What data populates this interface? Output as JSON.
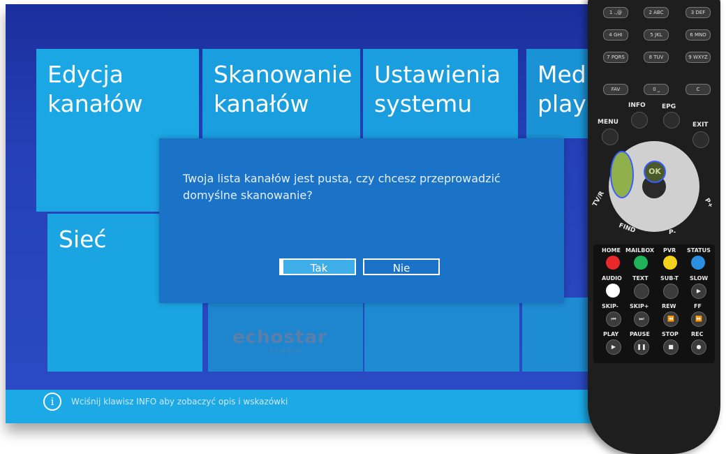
{
  "screen": {
    "tiles": {
      "edycja": "Edycja\nkanałów",
      "skanowanie": "Skanowanie\nkanałów",
      "ustawienia": "Ustawienia\nsystemu",
      "media": "Media\nplayer",
      "siec": "Sieć"
    },
    "logo": "echostar",
    "logo_sub": "STUDIO"
  },
  "dialog": {
    "message": "Twoja lista kanałów jest pusta, czy chcesz przeprowadzić domyślne skanowanie?",
    "yes_label": "Tak",
    "no_label": "Nie"
  },
  "infobar": {
    "icon_label": "i",
    "text": "Wciśnij klawisz INFO aby zobaczyć opis i wskazówki"
  },
  "remote": {
    "keys": [
      "1 .,@",
      "2 ABC",
      "3 DEF",
      "4 GHI",
      "5 JKL",
      "6 MNO",
      "7 PQRS",
      "8 TUV",
      "9 WXYZ",
      "FAV",
      "0 ⎵",
      "C"
    ],
    "labels": {
      "info": "INFO",
      "epg": "EPG",
      "menu": "MENU",
      "exit": "EXIT",
      "ok": "OK",
      "tvr": "TV/R",
      "pplus": "P+",
      "find": "FIND",
      "pminus": "P-",
      "home": "HOME",
      "mailbox": "MAILBOX",
      "pvr": "PVR",
      "status": "STATUS",
      "audio": "AUDIO",
      "text": "TEXT",
      "subt": "SUB-T",
      "slow": "SLOW",
      "skipm": "SKIP-",
      "skipp": "SKIP+",
      "rew": "REW",
      "ff": "FF",
      "play": "PLAY",
      "pause": "PAUSE",
      "stop": "STOP",
      "rec": "REC"
    },
    "colors": {
      "red": "#e8282b",
      "green": "#1fb45a",
      "yellow": "#f2d21a",
      "blue": "#2a8fe0",
      "white": "#ffffff"
    }
  }
}
